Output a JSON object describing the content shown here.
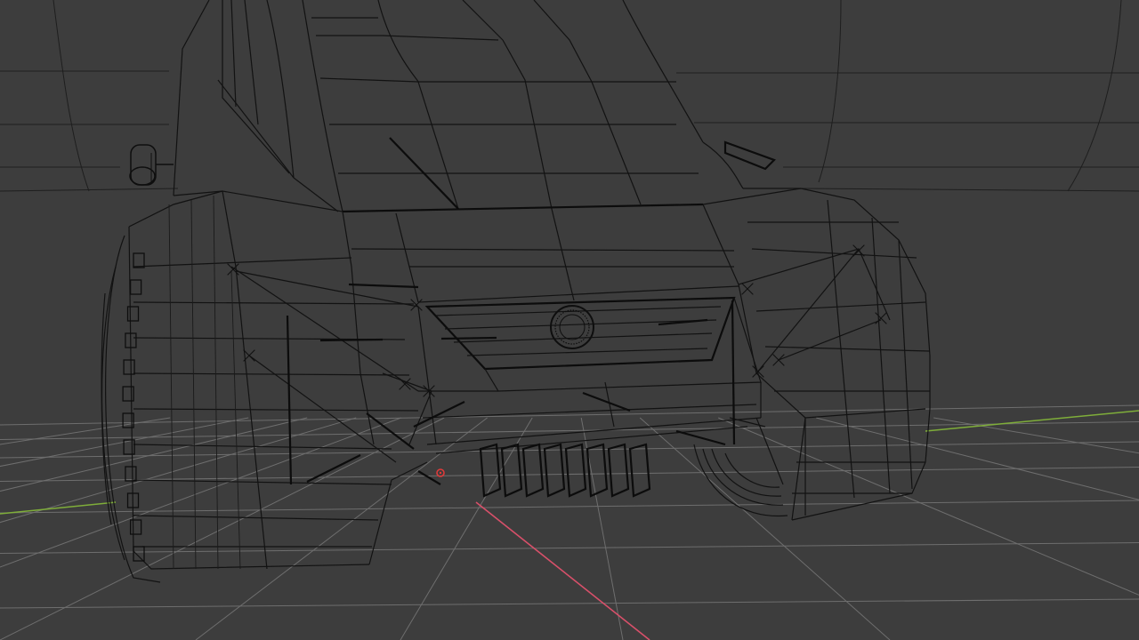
{
  "viewport": {
    "mode": "wireframe",
    "background_color": "#3d3d3d",
    "grid_color": "#6e6e6e",
    "wire_color": "#121212",
    "x_axis_color": "#d8506a",
    "y_axis_color": "#7fae3a",
    "origin_color": "#e03a3a"
  },
  "scene": {
    "object": "vehicle-front-wireframe",
    "grid_floor": "visible",
    "background_shell": "visible"
  }
}
